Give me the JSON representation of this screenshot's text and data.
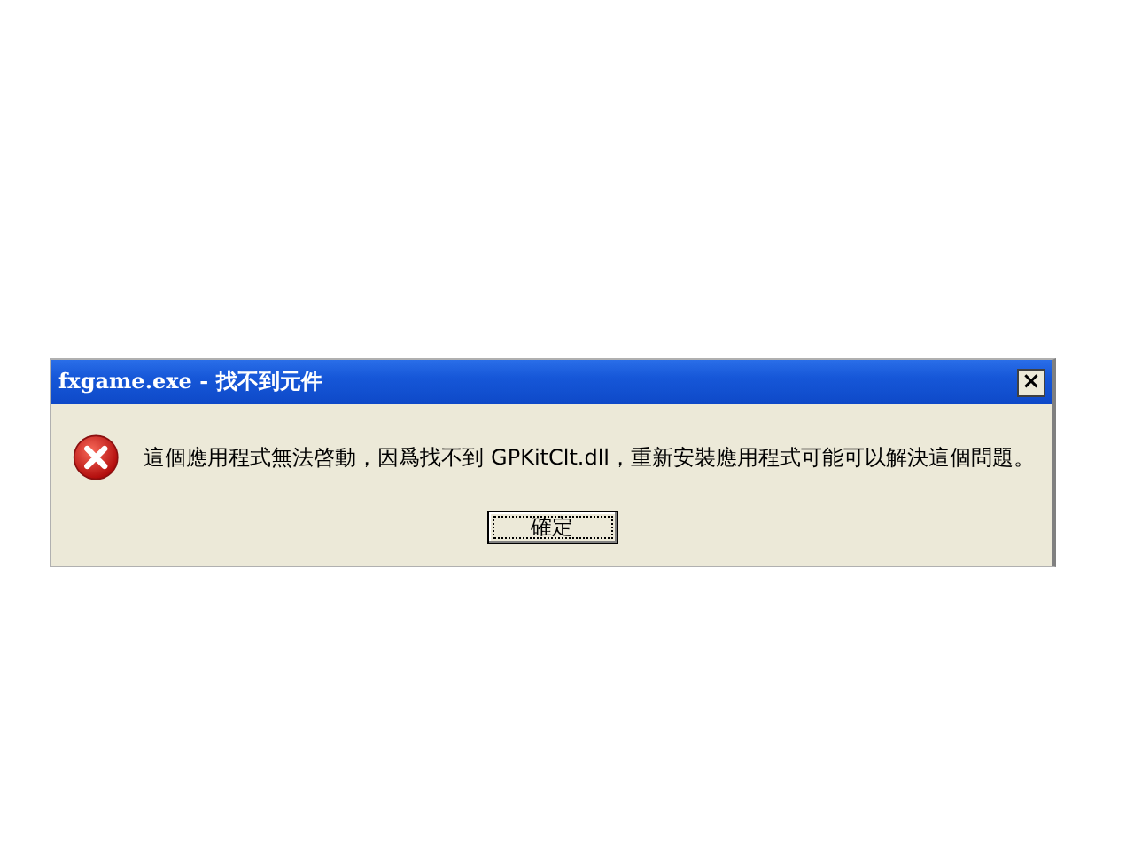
{
  "window": {
    "title": "fxgame.exe - 找不到元件",
    "close": "×"
  },
  "message": "這個應用程式無法啓動，因爲找不到 GPKitClt.dll，重新安裝應用程式可能可以解決這個問題。",
  "buttons": [
    {
      "label": "確定",
      "focused": true
    }
  ]
}
